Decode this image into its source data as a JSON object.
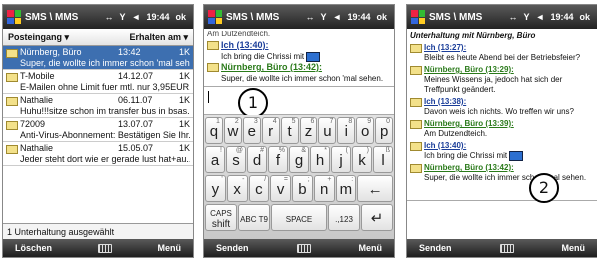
{
  "title_bar": {
    "app": "SMS \\ MMS",
    "connectivity": "↔",
    "signal": "Y",
    "volume": "◄",
    "time": "19:44",
    "ok": "ok"
  },
  "inbox": {
    "folder": "Posteingang ▾",
    "sort": "Erhalten am ▾",
    "messages": [
      {
        "from": "Nürnberg, Büro",
        "date": "13:42",
        "size": "1K",
        "preview": "Super, die wollte ich immer schon 'mal seh...",
        "selected": true
      },
      {
        "from": "T-Mobile",
        "date": "14.12.07",
        "size": "1K",
        "preview": "E-Mailen ohne Limit fuer mtl. nur 3,95EUR...."
      },
      {
        "from": "Nathalie",
        "date": "06.11.07",
        "size": "1K",
        "preview": "Huhu!!!sitze schon im transfer bus in bsas...."
      },
      {
        "from": "72009",
        "date": "13.07.07",
        "size": "1K",
        "preview": "Anti-Virus-Abonnement: Bestätigen Sie Ihr..."
      },
      {
        "from": "Nathalie",
        "date": "15.05.07",
        "size": "1K",
        "preview": "Jeder steht dort wie er gerade lust hat+au..."
      }
    ],
    "status": "1 Unterhaltung ausgewählt",
    "softkeys": {
      "left": "Löschen",
      "right": "Menü"
    }
  },
  "compose": {
    "partial_top": "Am Dutzendteich.",
    "entries": [
      {
        "sender": "Ich (13:40):",
        "text": "Ich bring die Chrissi mit"
      },
      {
        "sender": "Nürnberg, Büro (13:42):",
        "text": "Super, die wollte ich immer schon 'mal sehen."
      }
    ],
    "callout": "1",
    "keyboard": {
      "rows": [
        [
          [
            "q",
            "1"
          ],
          [
            "w",
            "2"
          ],
          [
            "e",
            "3"
          ],
          [
            "r",
            "4"
          ],
          [
            "t",
            "5"
          ],
          [
            "z",
            "6"
          ],
          [
            "u",
            "7"
          ],
          [
            "i",
            "8"
          ],
          [
            "o",
            "9"
          ],
          [
            "p",
            "0"
          ]
        ],
        [
          [
            "a",
            "!"
          ],
          [
            "s",
            "@"
          ],
          [
            "d",
            "#"
          ],
          [
            "f",
            "%"
          ],
          [
            "g",
            "&"
          ],
          [
            "h",
            "*"
          ],
          [
            "j",
            "("
          ],
          [
            "k",
            ")"
          ],
          [
            "l",
            "ß"
          ]
        ],
        [
          [
            "y",
            "'"
          ],
          [
            "x",
            "-"
          ],
          [
            "c",
            "/"
          ],
          [
            "v",
            "="
          ],
          [
            "b",
            ";"
          ],
          [
            "n",
            "+"
          ],
          [
            "m",
            ":"
          ]
        ]
      ],
      "ctrl": {
        "backspace": "←",
        "caps": "CAPS",
        "shift": "shift",
        "abc": "ABC T9",
        "space": "SPACE",
        "num": ".,123",
        "enter": "↵"
      }
    },
    "softkeys": {
      "left": "Senden",
      "right": "Menü"
    }
  },
  "conversation": {
    "header": "Unterhaltung mit Nürnberg, Büro",
    "entries": [
      {
        "sender": "Ich (13:27):",
        "text": "Bleibt es heute Abend bei der Betriebsfeier?",
        "mine": true
      },
      {
        "sender": "Nürnberg, Büro (13:29):",
        "text": "Meines Wissens ja, jedoch hat sich der Treffpunkt geändert.",
        "mine": false
      },
      {
        "sender": "Ich (13:38):",
        "text": "Davon weis ich nichts. Wo treffen wir uns?",
        "mine": true
      },
      {
        "sender": "Nürnberg, Büro (13:39):",
        "text": "Am Dutzendteich.",
        "mine": false
      },
      {
        "sender": "Ich (13:40):",
        "text": "Ich bring die Chrissi mit",
        "mine": true
      },
      {
        "sender": "Nürnberg, Büro (13:42):",
        "text": "Super, die wollte ich immer schon 'mal sehen.",
        "mine": false
      }
    ],
    "callout": "2",
    "softkeys": {
      "left": "Senden",
      "right": "Menü"
    }
  },
  "colors": {
    "selection": "#3d6fb0",
    "sender_me": "#1a3d99",
    "sender_other": "#2a7a1a"
  }
}
